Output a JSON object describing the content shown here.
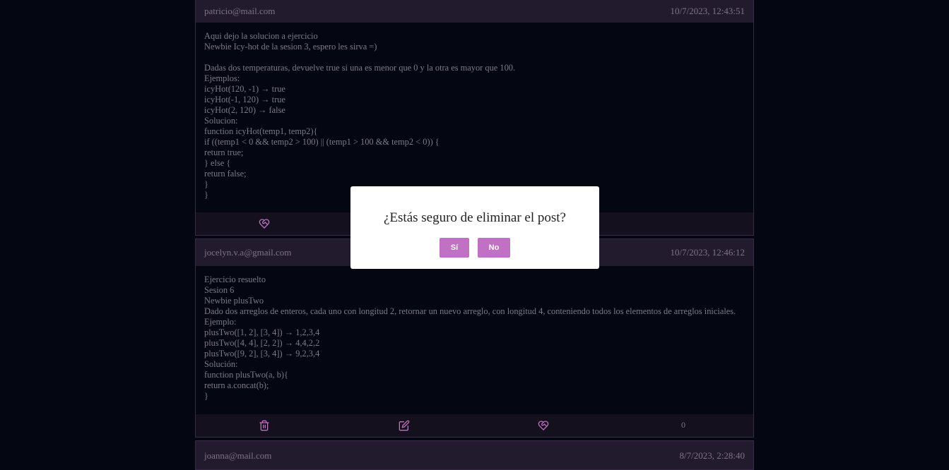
{
  "posts": [
    {
      "author": "patricio@mail.com",
      "date": "10/7/2023, 12:43:51",
      "body": "Aqui dejo la solucion a ejercicio\nNewbie Icy-hot de la sesion 3, espero les sirva =)\n\nDadas dos temperaturas, devuelve true si una es menor que 0 y la otra es mayor que 100.\nEjemplos:\nicyHot(120, -1) → true\nicyHot(-1, 120) → true\nicyHot(2, 120) → false\nSolucion:\nfunction icyHot(temp1, temp2){\nif ((temp1 < 0 && temp2 > 100) || (temp1 > 100 && temp2 < 0)) {\nreturn true;\n} else {\nreturn false;\n}\n}"
    },
    {
      "author": "jocelyn.v.a@gmail.com",
      "date": "10/7/2023, 12:46:12",
      "body": "Ejercicio resuelto\nSesion 6\nNewbie plusTwo\nDado dos arreglos de enteros, cada uno con longitud 2, retornar un nuevo arreglo, con longitud 4, conteniendo todos los elementos de arreglos iniciales.\nEjemplo:\nplusTwo([1, 2], [3, 4]) → 1,2,3,4\nplusTwo([4, 4], [2, 2]) → 4,4,2,2\nplusTwo([9, 2], [3, 4]) → 9,2,3,4\nSolución:\nfunction plusTwo(a, b){\nreturn a.concat(b);\n}",
      "likes": "0"
    },
    {
      "author": "joanna@mail.com",
      "date": "8/7/2023, 2:28:40"
    }
  ],
  "dialog": {
    "message": "¿Estás seguro de eliminar el post?",
    "yes_label": "Sí",
    "no_label": "No"
  },
  "icons": {
    "like": "heart-handshake-icon",
    "delete": "trash-icon",
    "edit": "edit-icon"
  },
  "colors": {
    "accent": "#c071c3",
    "background": "#040611",
    "header": "#221a2d"
  }
}
